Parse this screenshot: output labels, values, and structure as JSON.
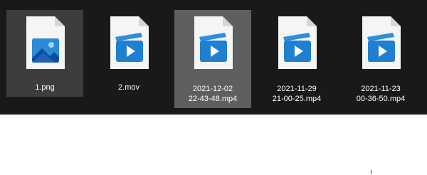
{
  "files": [
    {
      "name_line1": "1.png",
      "name_line2": "",
      "icon": "image-file-icon",
      "state": "selected"
    },
    {
      "name_line1": "2.mov",
      "name_line2": "",
      "icon": "video-file-icon",
      "state": "normal"
    },
    {
      "name_line1": "2021-12-02",
      "name_line2": "22-43-48.mp4",
      "icon": "video-file-icon",
      "state": "hover"
    },
    {
      "name_line1": "2021-11-29",
      "name_line2": "21-00-25.mp4",
      "icon": "video-file-icon",
      "state": "normal"
    },
    {
      "name_line1": "2021-11-23",
      "name_line2": "00-36-50.mp4",
      "icon": "video-file-icon",
      "state": "normal"
    }
  ],
  "colors": {
    "background": "#191919",
    "selected": "#3d3d3d",
    "hover": "#5f5f5f",
    "icon_blue": "#1f7fd1",
    "page_white": "#f5f5f5"
  }
}
